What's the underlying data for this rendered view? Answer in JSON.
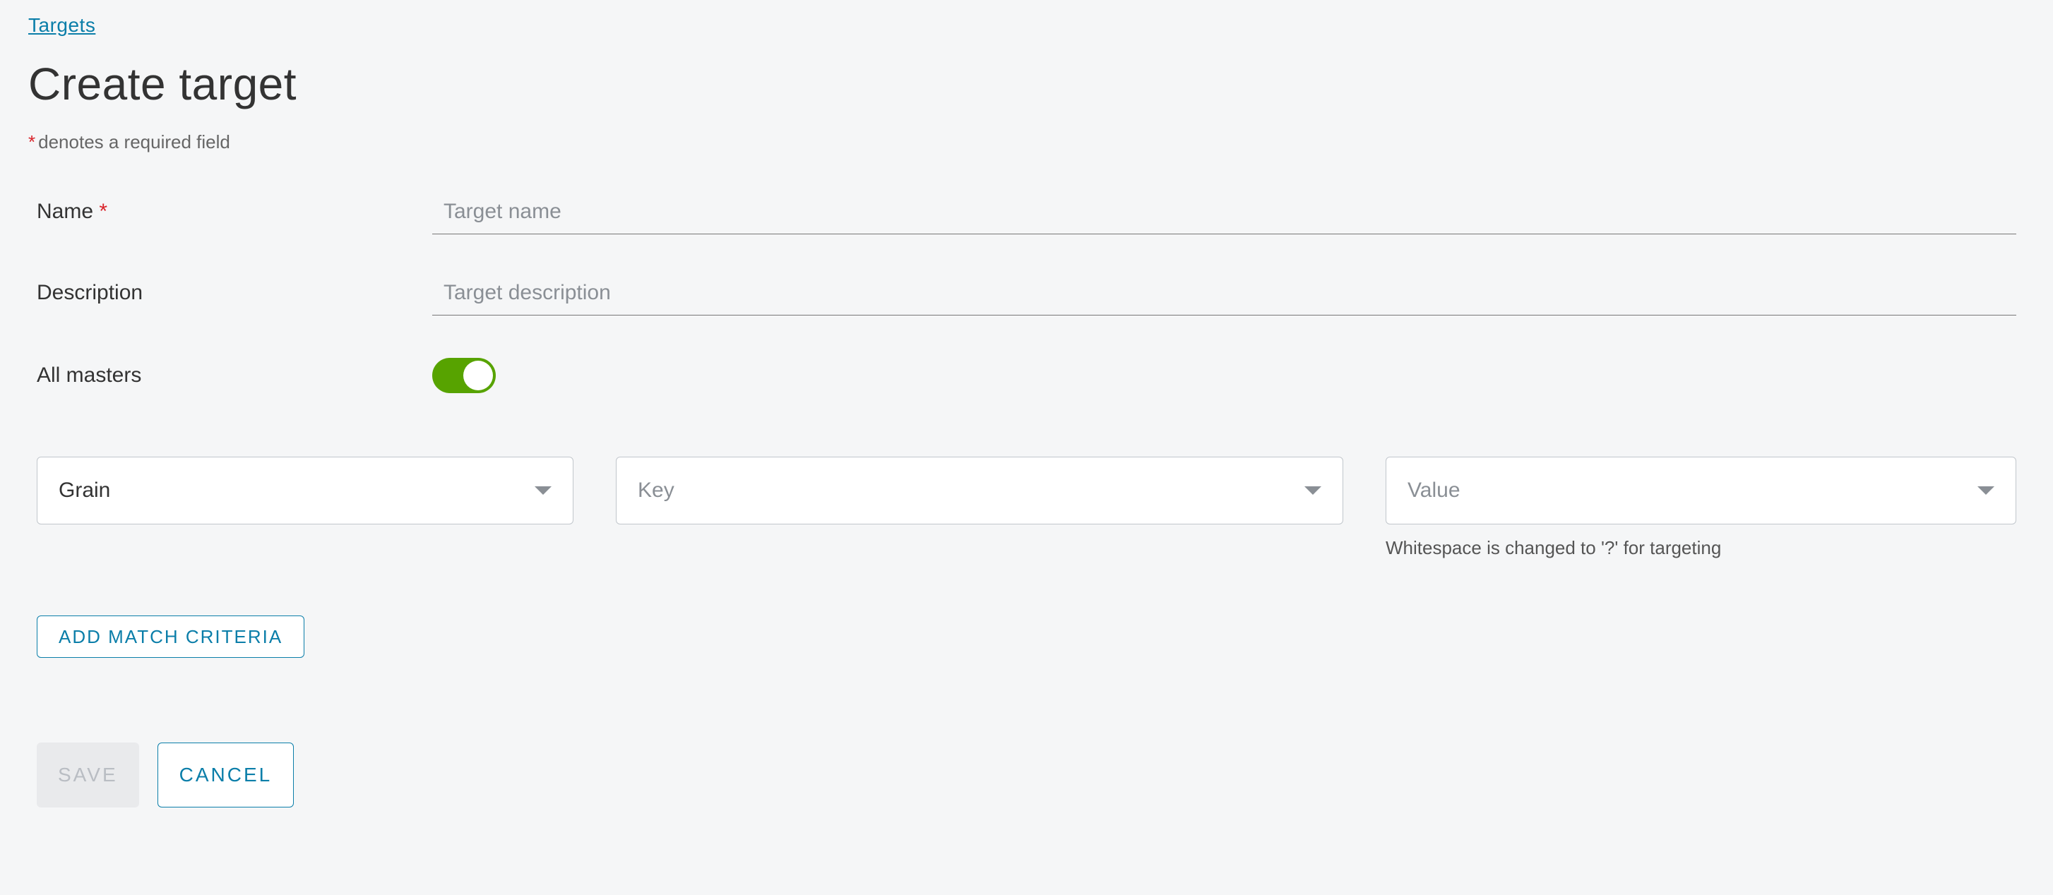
{
  "breadcrumb": {
    "targets": "Targets"
  },
  "page": {
    "title": "Create target",
    "required_note": "denotes a required field"
  },
  "form": {
    "name_label": "Name",
    "name_placeholder": "Target name",
    "name_value": "",
    "description_label": "Description",
    "description_placeholder": "Target description",
    "description_value": "",
    "all_masters_label": "All masters",
    "all_masters_on": true
  },
  "criteria": {
    "grain_selected": "Grain",
    "key_placeholder": "Key",
    "value_placeholder": "Value",
    "value_helper": "Whitespace is changed to '?' for targeting",
    "add_button": "ADD MATCH CRITERIA"
  },
  "actions": {
    "save": "SAVE",
    "cancel": "CANCEL"
  }
}
